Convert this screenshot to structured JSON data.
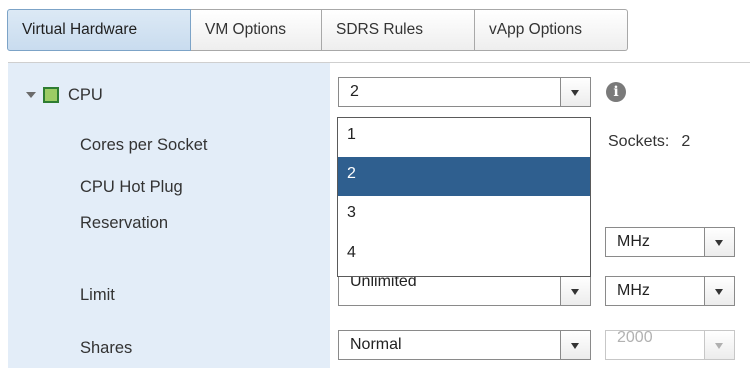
{
  "tabs": [
    {
      "label": "Virtual Hardware",
      "active": true
    },
    {
      "label": "VM Options",
      "active": false
    },
    {
      "label": "SDRS Rules",
      "active": false
    },
    {
      "label": "vApp Options",
      "active": false
    }
  ],
  "cpu": {
    "label": "CPU",
    "value": "2",
    "options": [
      "1",
      "2",
      "3",
      "4"
    ],
    "selected_option": "2"
  },
  "rows": {
    "cores_per_socket": {
      "label": "Cores per Socket",
      "sockets_label": "Sockets:",
      "sockets_value": "2"
    },
    "cpu_hot_plug": {
      "label": "CPU Hot Plug"
    },
    "reservation": {
      "label": "Reservation",
      "unit": "MHz"
    },
    "limit": {
      "label": "Limit",
      "value": "Unlimited",
      "unit": "MHz"
    },
    "shares": {
      "label": "Shares",
      "value": "Normal",
      "amount": "2000"
    }
  },
  "icons": {
    "expand": "triangle-down-icon",
    "cpu": "cpu-icon",
    "info": "info-icon"
  },
  "colors": {
    "active_tab": "#c9dcef",
    "label_column": "#e3edf8",
    "selected_option": "#2f5f8f"
  }
}
